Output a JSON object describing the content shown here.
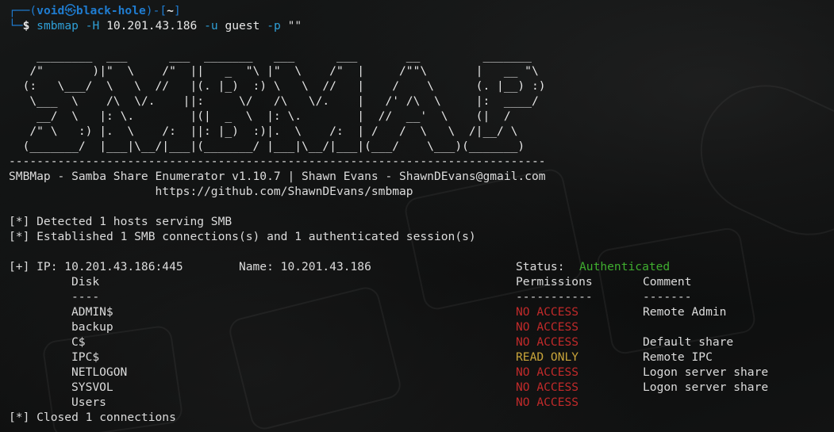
{
  "prompt": {
    "frame_top": "┌──(",
    "user": "void",
    "skull": "㉿",
    "host": "black-hole",
    "mid": ")-[",
    "dir": "~",
    "end": "]",
    "frame_bottom": "└─",
    "dollar": "$"
  },
  "command": {
    "program": "smbmap",
    "flag_h": "-H",
    "host_value": "10.201.43.186",
    "flag_u": "-u",
    "user_value": "guest",
    "flag_p": "-p",
    "pass_value": "\"\""
  },
  "banner": [
    "    ________  ___      ___  _______   ___      ___       __         _______",
    "   /\"       )|\"  \\    /\"  ||   _  \"\\ |\"  \\    /\"  |     /\"\"\\       |   __ \"\\",
    "  (:   \\___/  \\   \\  //   |(. |_)  :) \\   \\  //   |    /    \\      (. |__) :)",
    "   \\___  \\    /\\  \\/.    ||:     \\/   /\\   \\/.    |   /' /\\  \\     |:  ____/",
    "    __/  \\   |: \\.        |(|  _  \\  |: \\.        |  //  __'  \\    (|  /",
    "   /\" \\   :) |.  \\    /:  ||: |_)  :)|.  \\    /:  | /   /  \\   \\  /|__/ \\",
    "  (_______/  |___|\\__/|___|(_______/ |___|\\__/|___|(___/    \\___)(_______)"
  ],
  "separator": "-----------------------------------------------------------------------------",
  "about": {
    "line1": "SMBMap - Samba Share Enumerator v1.10.7 | Shawn Evans - ShawnDEvans@gmail.com",
    "line2": "                     https://github.com/ShawnDEvans/smbmap"
  },
  "messages": {
    "detected": "[*] Detected 1 hosts serving SMB",
    "established": "[*] Established 1 SMB connections(s) and 1 authenticated session(s)",
    "closed": "[*] Closed 1 connections"
  },
  "result": {
    "ip_line": "[+] IP: 10.201.43.186:445        Name: 10.201.43.186",
    "status_label": "Status: ",
    "status_value": "Authenticated",
    "col_disk": "Disk",
    "col_disk_rule": "----",
    "col_permissions": "Permissions",
    "col_permissions_rule": "-----------",
    "col_comment": "Comment",
    "col_comment_rule": "-------"
  },
  "shares": [
    {
      "name": "ADMIN$",
      "permission": "NO ACCESS",
      "comment": "Remote Admin",
      "permission_color": "#c12a2a"
    },
    {
      "name": "backup",
      "permission": "NO ACCESS",
      "comment": "",
      "permission_color": "#c12a2a"
    },
    {
      "name": "C$",
      "permission": "NO ACCESS",
      "comment": "Default share",
      "permission_color": "#c12a2a"
    },
    {
      "name": "IPC$",
      "permission": "READ ONLY",
      "comment": "Remote IPC",
      "permission_color": "#c8a43a"
    },
    {
      "name": "NETLOGON",
      "permission": "NO ACCESS",
      "comment": "Logon server share",
      "permission_color": "#c12a2a"
    },
    {
      "name": "SYSVOL",
      "permission": "NO ACCESS",
      "comment": "Logon server share",
      "permission_color": "#c12a2a"
    },
    {
      "name": "Users",
      "permission": "NO ACCESS",
      "comment": "",
      "permission_color": "#c12a2a"
    }
  ],
  "colors": {
    "prompt_blue": "#1f7cd0",
    "command_blue": "#2f9fd6",
    "authenticated_green": "#3fae2f",
    "no_access_red": "#c12a2a",
    "read_only_yellow": "#c8a43a"
  }
}
